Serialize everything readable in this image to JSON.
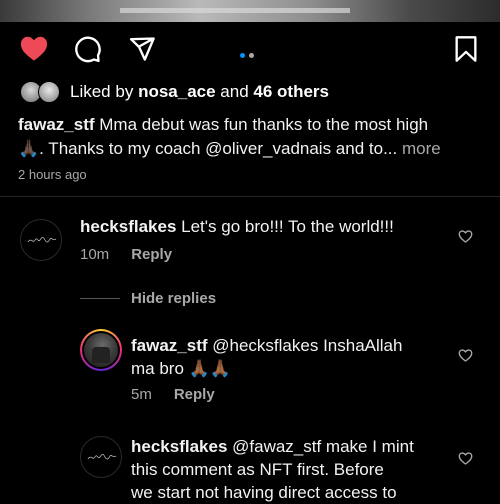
{
  "post": {
    "liked_by_prefix": "Liked by",
    "liked_by_user": "nosa_ace",
    "liked_by_and": "and",
    "liked_by_others": "46 others",
    "caption_user": "fawaz_stf",
    "caption_line1": "Mma debut was fun thanks to the most high",
    "caption_emoji": "🙏🏿",
    "caption_line2": ". Thanks to my coach @oliver_vadnais and to",
    "caption_ellipsis": "...",
    "more_label": "more",
    "time_ago": "2 hours ago",
    "carousel": {
      "count": 2,
      "active_index": 0,
      "active_color": "#0095f6",
      "inactive_color": "#a8a8a8"
    },
    "like_color": "#ed4956"
  },
  "comments": [
    {
      "user": "hecksflakes",
      "text": "Let's go bro!!! To the world!!!",
      "time": "10m",
      "reply_label": "Reply"
    },
    {
      "hide_replies_label": "Hide replies"
    },
    {
      "user": "fawaz_stf",
      "text": "@hecksflakes InshaAllah",
      "text_line2": "ma bro 🙏🏾🙏🏾",
      "time": "5m",
      "reply_label": "Reply"
    },
    {
      "user": "hecksflakes",
      "text_line1": "@fawaz_stf make I mint",
      "text_line2": "this comment as NFT first.  Before",
      "text_line3": "we start not having direct access to"
    }
  ]
}
